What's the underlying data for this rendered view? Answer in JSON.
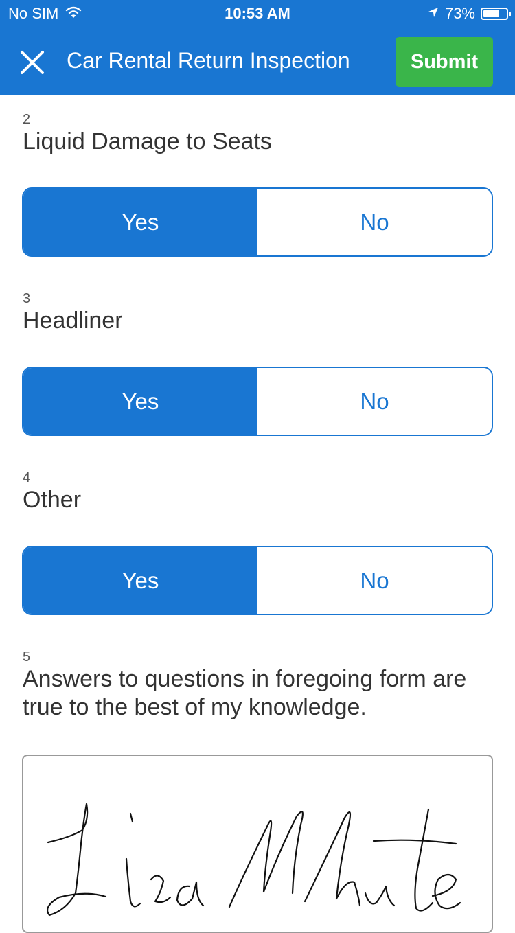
{
  "status_bar": {
    "carrier": "No SIM",
    "time": "10:53 AM",
    "battery": "73%",
    "battery_level": 0.73
  },
  "nav": {
    "title": "Car Rental Return Inspection",
    "submit_label": "Submit"
  },
  "questions": [
    {
      "number": "2",
      "text": "Liquid Damage to Seats",
      "yes_label": "Yes",
      "no_label": "No",
      "selected": "Yes"
    },
    {
      "number": "3",
      "text": "Headliner",
      "yes_label": "Yes",
      "no_label": "No",
      "selected": "Yes"
    },
    {
      "number": "4",
      "text": "Other",
      "yes_label": "Yes",
      "no_label": "No",
      "selected": "Yes"
    },
    {
      "number": "5",
      "text": "Answers to questions in foregoing form are true to the best of my knowledge."
    }
  ],
  "signature": {
    "text": "Lisa White"
  },
  "colors": {
    "primary": "#1976d2",
    "submit": "#3ab54a",
    "text": "#333333"
  }
}
